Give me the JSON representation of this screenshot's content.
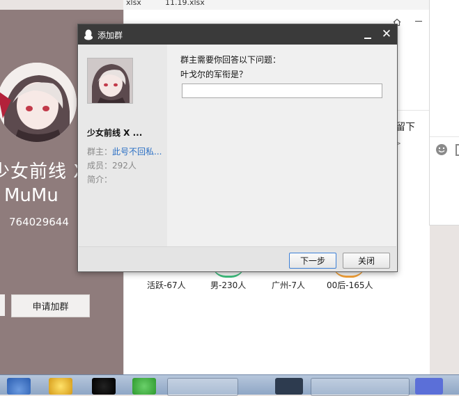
{
  "background_files": {
    "file1": "xlsx",
    "file2": "11.19.xlsx"
  },
  "group_card": {
    "name": "少女前线 X",
    "subname": "MuMu",
    "id": "764029644",
    "apply_button": "申请加群"
  },
  "info_window": {
    "partial_text": "留下",
    "stats": [
      {
        "label": "活跃-67人",
        "color": "#4caf50"
      },
      {
        "label": "男-230人",
        "color": "#3fbf7f"
      },
      {
        "label": "广州-7人",
        "color": "#4a9be8"
      },
      {
        "label": "00后-165人",
        "color": "#f3a23a"
      }
    ]
  },
  "dialog": {
    "title": "添加群",
    "group_name": "少女前线 X ...",
    "owner_label": "群主：",
    "owner_name": "此号不回私...",
    "members": "成员：292人",
    "intro": "简介：",
    "question_prompt": "群主需要你回答以下问题：",
    "question": "叶戈尔的军衔是？",
    "answer_value": "",
    "next_button": "下一步",
    "close_button": "关闭"
  },
  "colors": {
    "left_panel": "#8f7c7c",
    "title_bar": "#3a3a3a",
    "link": "#2a6fc4"
  }
}
